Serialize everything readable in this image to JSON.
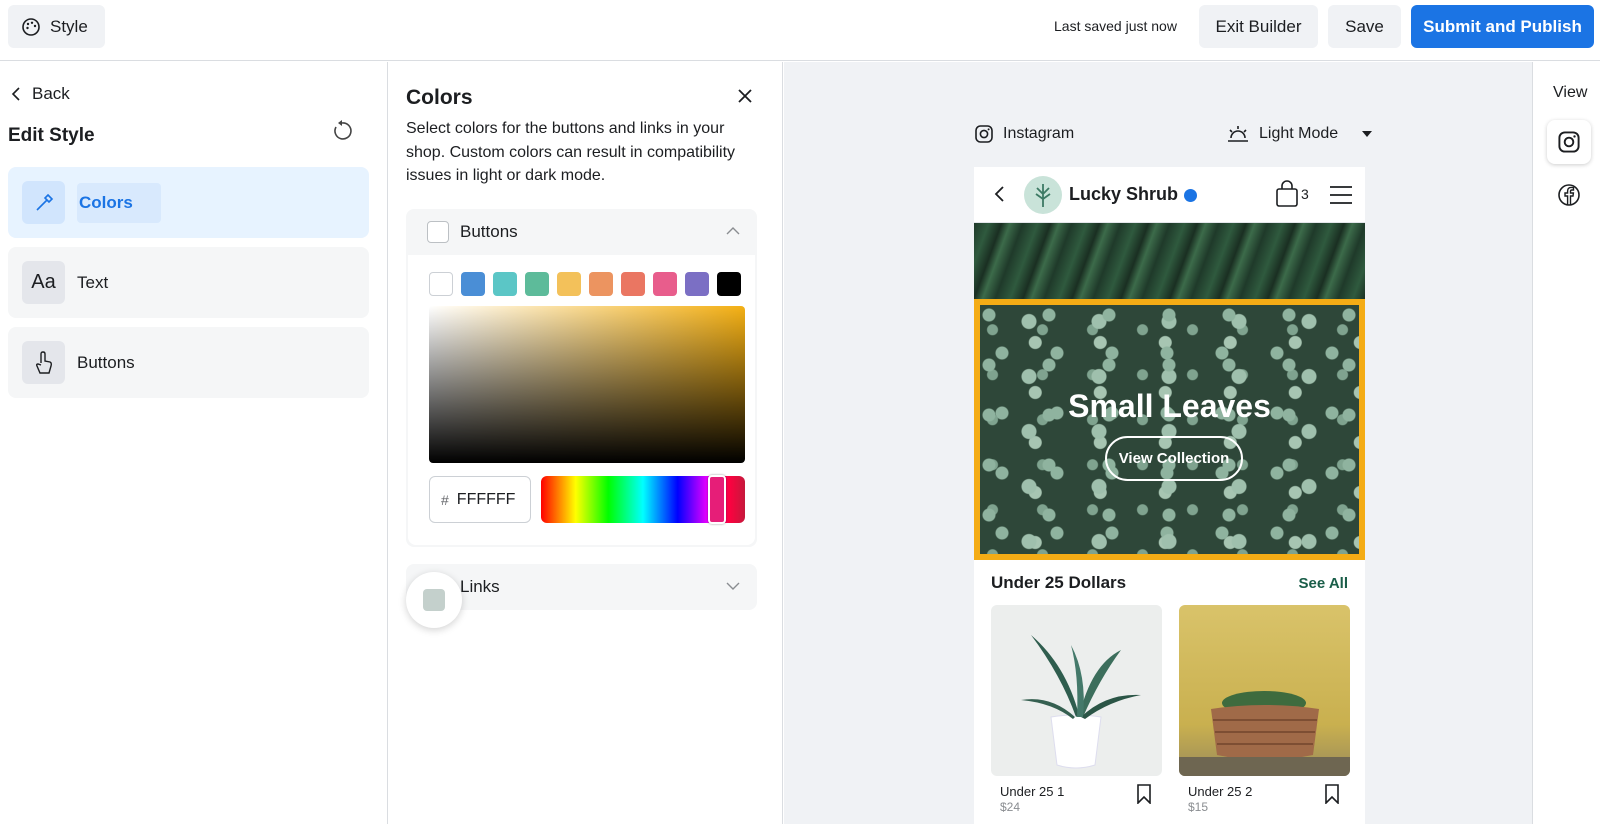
{
  "topbar": {
    "style_label": "Style",
    "last_saved": "Last saved just now",
    "exit_label": "Exit Builder",
    "save_label": "Save",
    "submit_label": "Submit and Publish"
  },
  "sidebar": {
    "back_label": "Back",
    "title": "Edit Style",
    "items": [
      {
        "label": "Colors",
        "icon": "eyedropper-icon",
        "active": true
      },
      {
        "label": "Text",
        "icon": "text-aa-icon",
        "active": false
      },
      {
        "label": "Buttons",
        "icon": "pointer-hand-icon",
        "active": false
      }
    ]
  },
  "colors_panel": {
    "title": "Colors",
    "description": "Select colors for the buttons and links in your shop. Custom colors can result in compatibility issues in light or dark mode.",
    "buttons_section": {
      "label": "Buttons",
      "swatches": [
        "#ffffff",
        "#4a8ed6",
        "#5bc6c6",
        "#5dbb9a",
        "#f3c15a",
        "#ec9460",
        "#ea7662",
        "#e85d8c",
        "#7b6fc4",
        "#000000"
      ],
      "hex_hash": "#",
      "hex_value": "FFFFFF",
      "gradient_hue": "#f4b014"
    },
    "links_section": {
      "label": "Links",
      "swatch_color": "#c4d0cc"
    }
  },
  "preview": {
    "platform_label": "Instagram",
    "mode_label": "Light Mode",
    "shop": {
      "name": "Lucky Shrub",
      "cart_count": "3"
    },
    "hero": {
      "title": "Small Leaves",
      "button_label": "View Collection",
      "border_color": "#f4ac15"
    },
    "section": {
      "title": "Under 25 Dollars",
      "see_all": "See All"
    },
    "products": [
      {
        "name": "Under 25 1",
        "price": "$24"
      },
      {
        "name": "Under 25 2",
        "price": "$15"
      }
    ]
  },
  "right_rail": {
    "view_label": "View"
  },
  "colors": {
    "accent": "#1b74e4",
    "see_all": "#1a5e49"
  }
}
